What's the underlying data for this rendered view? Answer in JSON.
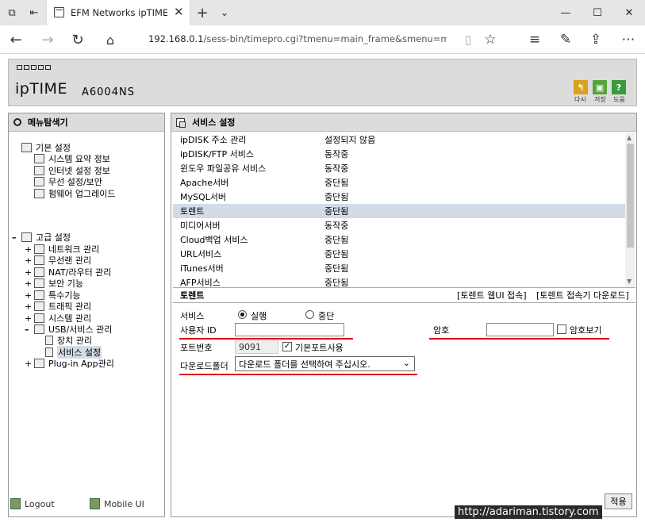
{
  "browser": {
    "tab_title": "EFM Networks ipTIME A",
    "url_host": "192.168.0.1",
    "url_path": "/sess-bin/timepro.cgi?tmenu=main_frame&smenu=main_frar"
  },
  "header": {
    "logo_main": "ipTIME",
    "model": "A6004NS",
    "actions": [
      {
        "label": "다시",
        "color": "#d9a21c",
        "icon": "back-arrow-icon"
      },
      {
        "label": "저장",
        "color": "#53a43a",
        "icon": "save-disk-icon"
      },
      {
        "label": "도움",
        "color": "#3a9a3a",
        "icon": "question-icon"
      }
    ]
  },
  "left_panel": {
    "title": "메뉴탐색기",
    "basic": {
      "label": "기본 설정",
      "items": [
        "시스템 요약 정보",
        "인터넷 설정 정보",
        "무선 설정/보안",
        "펌웨어 업그레이드"
      ]
    },
    "advanced": {
      "label": "고급 설정",
      "items": [
        "네트워크 관리",
        "무선랜 관리",
        "NAT/라우터 관리",
        "보안 기능",
        "특수기능",
        "트래픽 관리",
        "시스템 관리",
        "USB/서비스 관리"
      ],
      "usb_children": [
        "장치 관리",
        "서비스 설정"
      ],
      "plugin": "Plug-in App관리"
    },
    "logout": "Logout",
    "mobile": "Mobile UI"
  },
  "right_panel": {
    "title": "서비스 설정",
    "services": [
      {
        "name": "ipDISK 주소 관리",
        "status": "설정되지 않음"
      },
      {
        "name": "ipDISK/FTP 서비스",
        "status": "동작중"
      },
      {
        "name": "윈도우 파일공유 서비스",
        "status": "동작중"
      },
      {
        "name": "Apache서버",
        "status": "중단됨"
      },
      {
        "name": "MySQL서버",
        "status": "중단됨"
      },
      {
        "name": "토렌트",
        "status": "중단됨"
      },
      {
        "name": "미디어서버",
        "status": "동작중"
      },
      {
        "name": "Cloud백업 서비스",
        "status": "중단됨"
      },
      {
        "name": "URL서비스",
        "status": "중단됨"
      },
      {
        "name": "iTunes서버",
        "status": "중단됨"
      },
      {
        "name": "AFP서비스",
        "status": "중단됨"
      }
    ],
    "selected_service": "토렌트",
    "section_title": "토렌트",
    "link_web": "[토렌트 웹UI 접속]",
    "link_download": "[토렌트 접속기 다운로드]",
    "form": {
      "service_label": "서비스",
      "run_label": "실행",
      "stop_label": "중단",
      "user_id_label": "사용자 ID",
      "user_id_value": "",
      "password_label": "암호",
      "password_value": "",
      "show_password_label": "암호보기",
      "port_label": "포트번호",
      "port_value": "9091",
      "default_port_label": "기본포트사용",
      "folder_label": "다운로드폴더",
      "folder_value": "다운로드 폴더를 선택하여 주십시오."
    },
    "apply": "적용"
  },
  "watermark": "http://adariman.tistory.com"
}
